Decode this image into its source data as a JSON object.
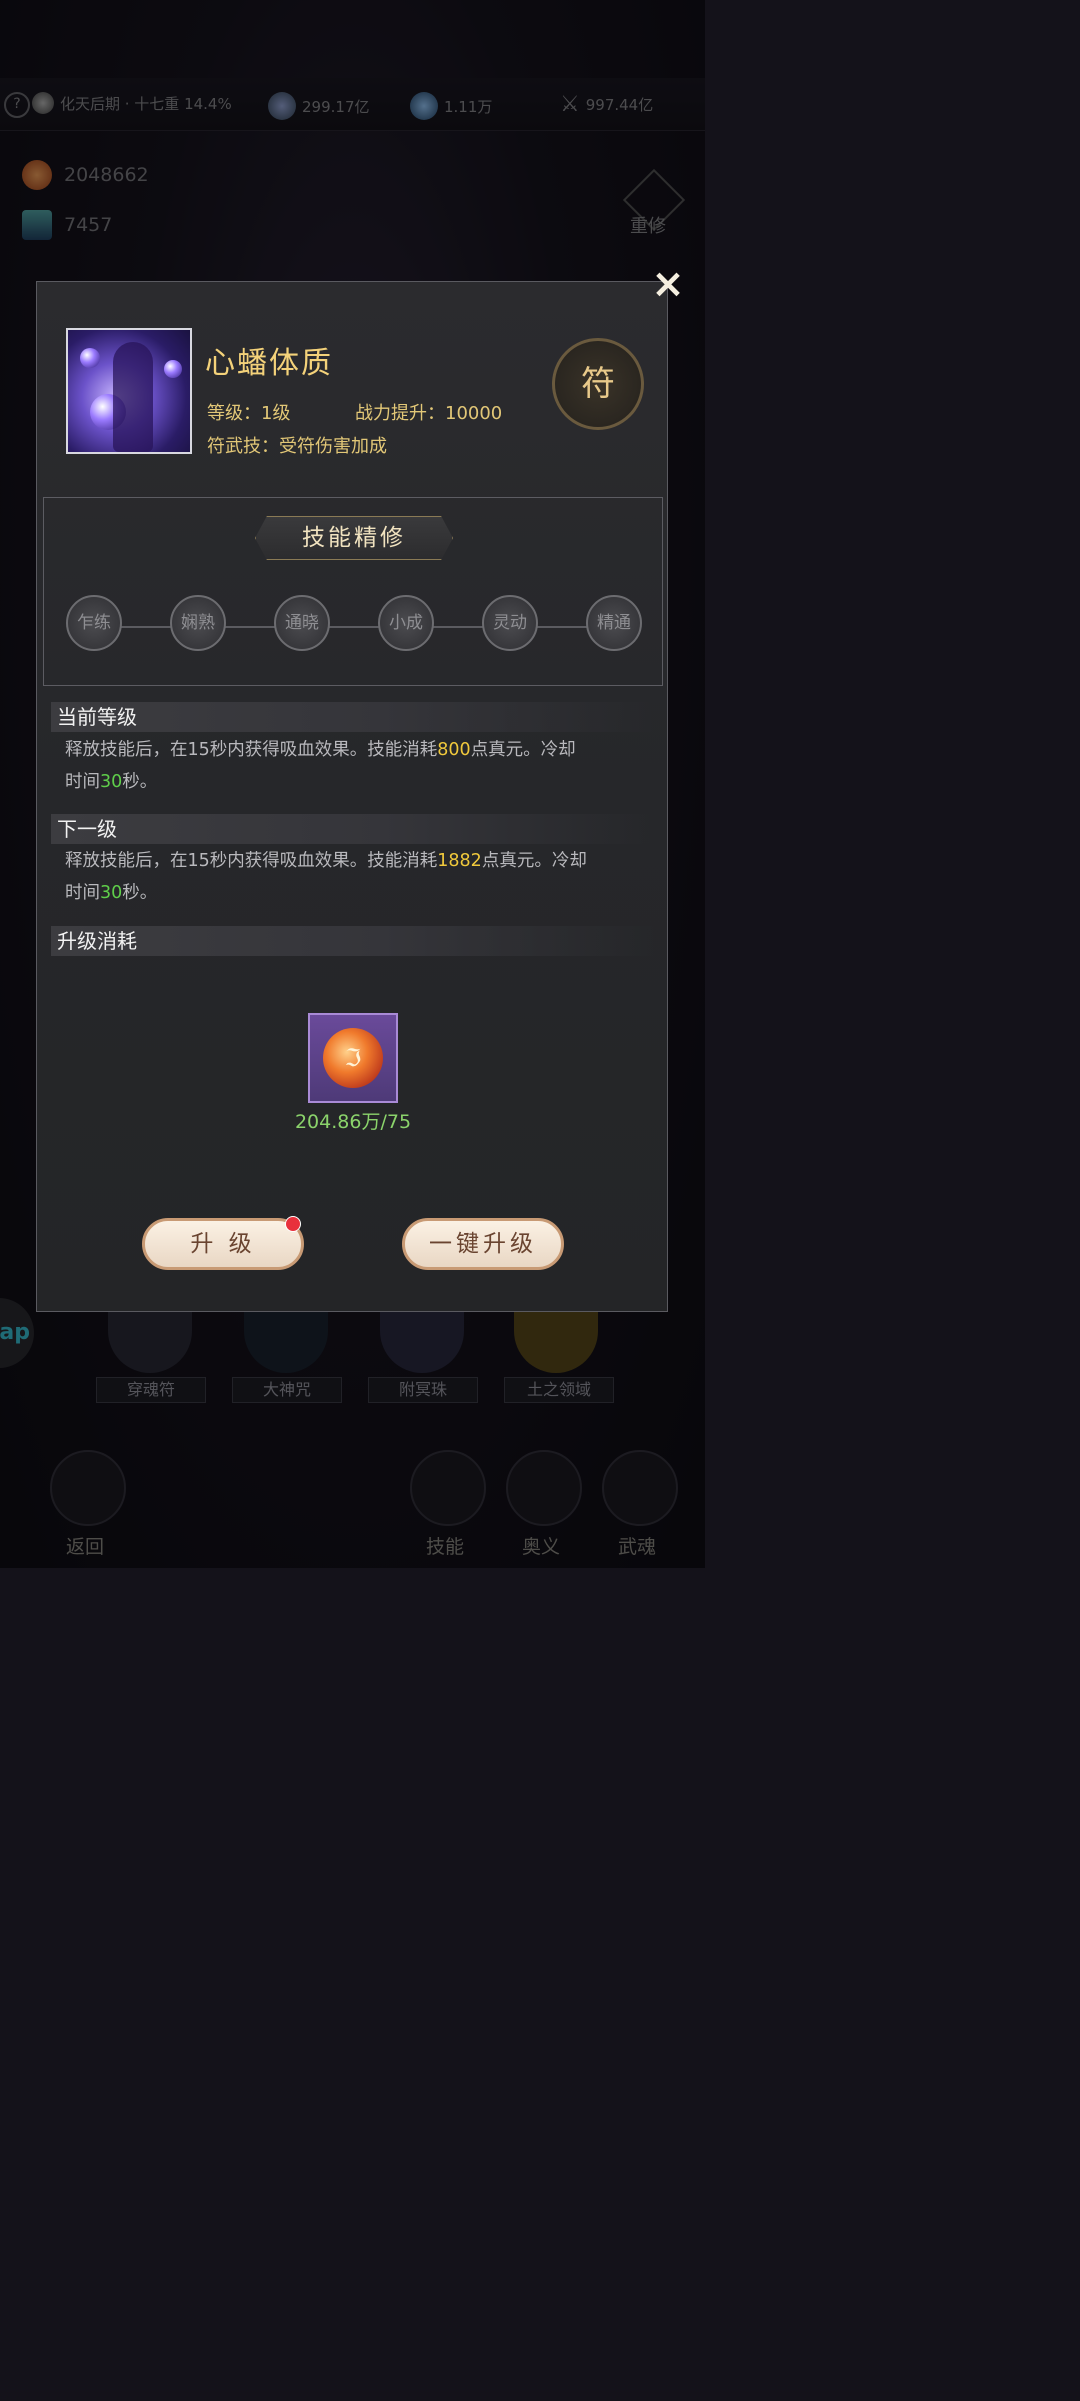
{
  "background": {
    "topbar": {
      "help_icon": "?",
      "realm": "化天后期 · 十七重 14.4%",
      "currency1": "299.17亿",
      "currency2": "1.11万",
      "power": "997.44亿"
    },
    "resource1": "2048662",
    "resource2": "7457",
    "rebuild_label": "重修",
    "skill_slots": [
      "穿魂符",
      "大神咒",
      "附冥珠",
      "土之领域"
    ],
    "nav": {
      "back": "返回",
      "skill": "技能",
      "mystery": "奥义",
      "soul": "武魂"
    },
    "side_tab": "ap"
  },
  "modal": {
    "close_icon": "×",
    "skill_name": "心蟠体质",
    "level": "等级：1级",
    "power_boost": "战力提升：10000",
    "talisman_skill": "符武技：受符伤害加成",
    "emblem": "符",
    "refine": {
      "title": "技能精修",
      "stages": [
        "乍练",
        "娴熟",
        "通晓",
        "小成",
        "灵动",
        "精通"
      ]
    },
    "current": {
      "header": "当前等级",
      "text_a": "释放技能后，在15秒内获得吸血效果。技能消耗",
      "cost": "800",
      "text_b": "点真元。冷却",
      "text_c": "时间",
      "cooldown": "30",
      "text_d": "秒。"
    },
    "next": {
      "header": "下一级",
      "text_a": "释放技能后，在15秒内获得吸血效果。技能消耗",
      "cost": "1882",
      "text_b": "点真元。冷却",
      "text_c": "时间",
      "cooldown": "30",
      "text_d": "秒。"
    },
    "upgrade_cost": {
      "header": "升级消耗",
      "item_icon": "fire-orb-icon",
      "item_glyph": "ℑ",
      "count": "204.86万/75"
    },
    "buttons": {
      "upgrade": "升 级",
      "one_click": "一键升级"
    }
  },
  "colors": {
    "gold": "#f4d27a",
    "highlight_yellow": "#f0c93c",
    "highlight_green": "#5fce4a"
  }
}
